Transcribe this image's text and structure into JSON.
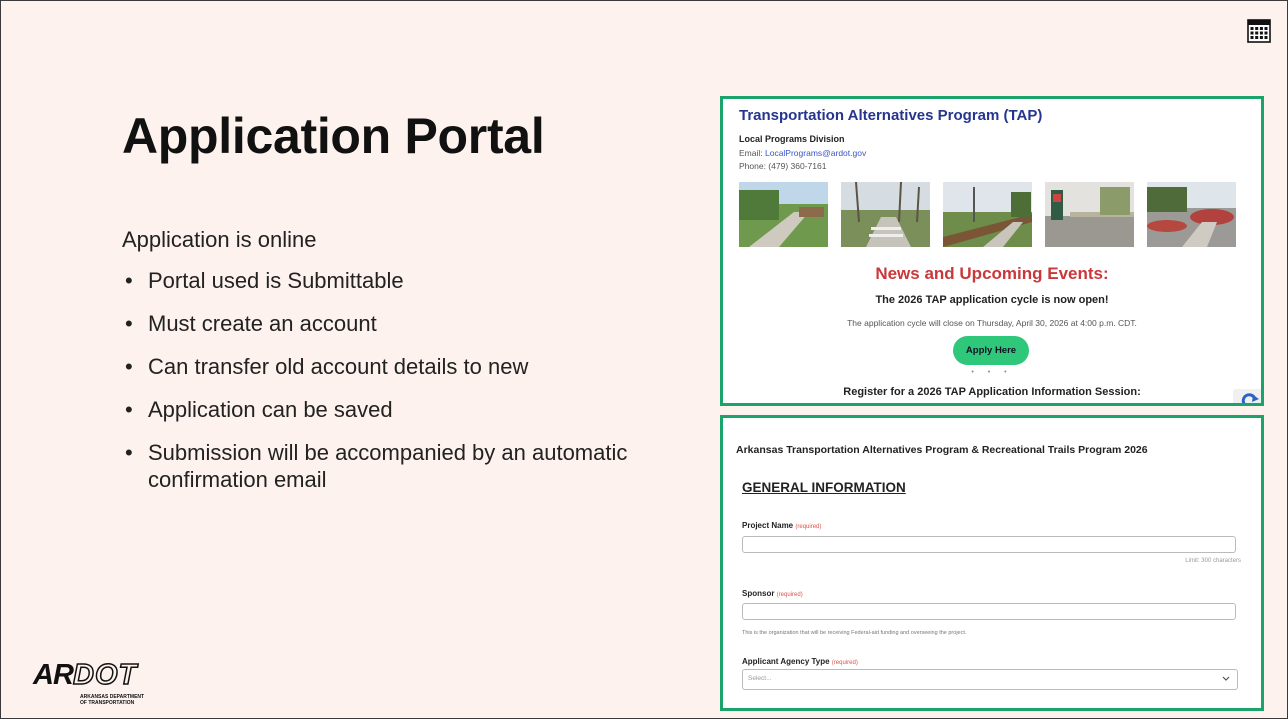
{
  "slide": {
    "title": "Application Portal",
    "intro": "Application is online",
    "bullet_glyph": "•",
    "bullets": [
      "Portal used is Submittable",
      "Must create an account",
      "Can transfer old account details to new",
      "Application can be saved",
      "Submission will be accompanied by an automatic confirmation email"
    ],
    "icon": "calendar-icon"
  },
  "logo": {
    "mark": "ARDOT",
    "mark_part1": "AR",
    "mark_part2": "DOT",
    "subtitle_line1": "ARKANSAS DEPARTMENT",
    "subtitle_line2": "OF TRANSPORTATION"
  },
  "tap_page": {
    "title": "Transportation Alternatives Program (TAP)",
    "division": "Local Programs Division",
    "email_label": "Email: ",
    "email": "LocalPrograms@ardot.gov",
    "phone": "Phone: (479) 360-7161",
    "news_heading": "News and Upcoming Events:",
    "open_notice": "The 2026 TAP application cycle is now open!",
    "close_notice": "The application cycle will close on Thursday, April 30, 2026 at 4:00 p.m. CDT.",
    "apply_button": "Apply Here",
    "separator": "• • •",
    "register_text": "Register for a 2026 TAP Application Information Session:"
  },
  "form_page": {
    "title": "Arkansas Transportation Alternatives Program & Recreational Trails Program 2026",
    "section_heading": "GENERAL INFORMATION",
    "required_tag": "(required)",
    "fields": {
      "project_name": {
        "label": "Project Name",
        "limit": "Limit: 300 characters"
      },
      "sponsor": {
        "label": "Sponsor",
        "help": "This is the organization that will be receiving Federal-aid funding and overseeing the project."
      },
      "agency_type": {
        "label": "Applicant Agency Type",
        "placeholder": "Select..."
      }
    }
  },
  "colors": {
    "slide_bg": "#fdf2ee",
    "panel_border": "#1aa36a",
    "tap_title": "#26368f",
    "news_red": "#c9383a",
    "apply_green": "#2fc77a"
  }
}
